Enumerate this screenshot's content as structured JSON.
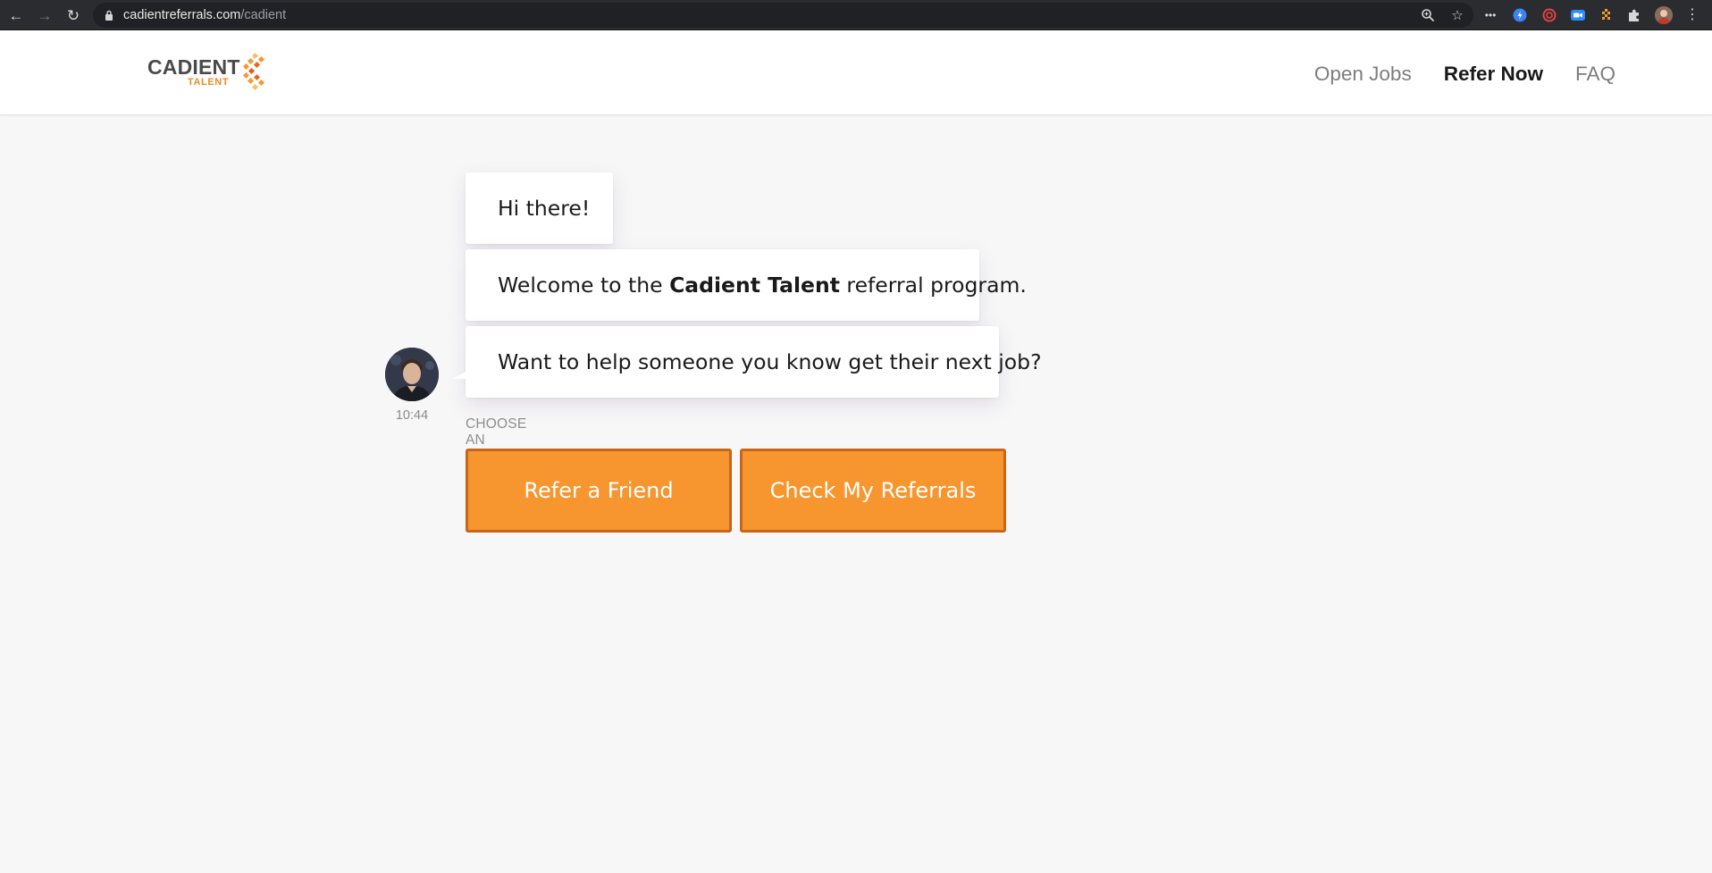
{
  "browser": {
    "url_host": "cadientreferrals.com",
    "url_path": "/cadient",
    "icons": {
      "back": "arrow-left-icon",
      "forward": "arrow-right-icon",
      "reload": "reload-icon",
      "lock": "lock-icon",
      "zoom": "zoom-icon",
      "bookmark": "star-icon",
      "extensions": "puzzle-icon",
      "menu": "kebab-menu-icon"
    }
  },
  "header": {
    "logo": {
      "word": "CADIENT",
      "sub": "TALENT"
    },
    "nav": [
      {
        "label": "Open Jobs",
        "active": false
      },
      {
        "label": "Refer Now",
        "active": true
      },
      {
        "label": "FAQ",
        "active": false
      }
    ]
  },
  "chat": {
    "messages": [
      {
        "text": "Hi there!"
      },
      {
        "prefix": "Welcome to the ",
        "bold": "Cadient Talent",
        "suffix": " referral program."
      },
      {
        "text": "Want to help someone you know get their next job?"
      }
    ],
    "timestamp": "10:44",
    "choose_label": "CHOOSE AN OPTION",
    "options": [
      {
        "label": "Refer a Friend"
      },
      {
        "label": "Check My Referrals"
      }
    ]
  },
  "colors": {
    "accent": "#f7952e",
    "accent_border": "#c7651a",
    "page_bg": "#f7f7f7",
    "logo_text": "#4a4a4a",
    "logo_orange": "#f08a24"
  }
}
